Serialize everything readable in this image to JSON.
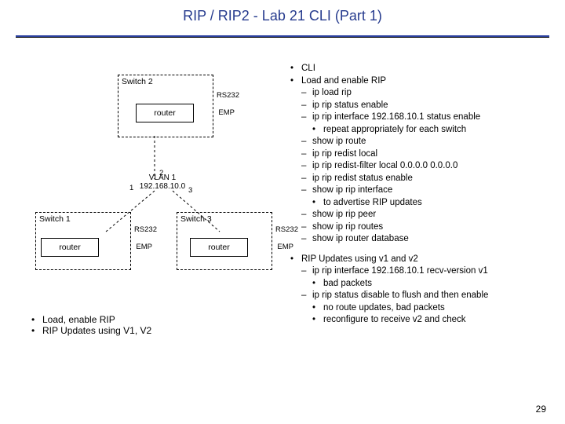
{
  "title": "RIP / RIP2 - Lab 21 CLI (Part 1)",
  "page_number": "29",
  "diagram": {
    "switch_top": "Switch 2",
    "switch_left": "Switch 1",
    "switch_right": "Switch 3",
    "router": "router",
    "rs232": "RS232",
    "emp": "EMP",
    "vlan_line1": "VLAN 1",
    "vlan_line2": "192.168.10.0",
    "port1": "1",
    "port2": "2",
    "port3": "3"
  },
  "left_bullets": {
    "i0": "Load, enable RIP",
    "i1": "RIP Updates using V1, V2"
  },
  "cli": {
    "h0": "CLI",
    "h1": "Load and enable RIP",
    "a0": "ip load rip",
    "a1": "ip rip status enable",
    "a2": "ip rip interface 192.168.10.1 status enable",
    "a2s": "repeat appropriately for each switch",
    "a3": "show ip route",
    "a4": "ip rip redist local",
    "a5": "ip rip redist-filter local 0.0.0.0 0.0.0.0",
    "a6": "ip rip redist status enable",
    "a7": "show ip rip interface",
    "a7s": "to advertise RIP updates",
    "a8": "show ip rip peer",
    "a9": "show ip rip routes",
    "a10": "show ip router database",
    "h2": "RIP Updates using v1 and v2",
    "b0": "ip rip interface 192.168.10.1 recv-version v1",
    "b0s": "bad packets",
    "b1": "ip rip status disable to flush and then enable",
    "b1s0": "no route updates, bad packets",
    "b1s1": "reconfigure to receive v2 and check"
  }
}
